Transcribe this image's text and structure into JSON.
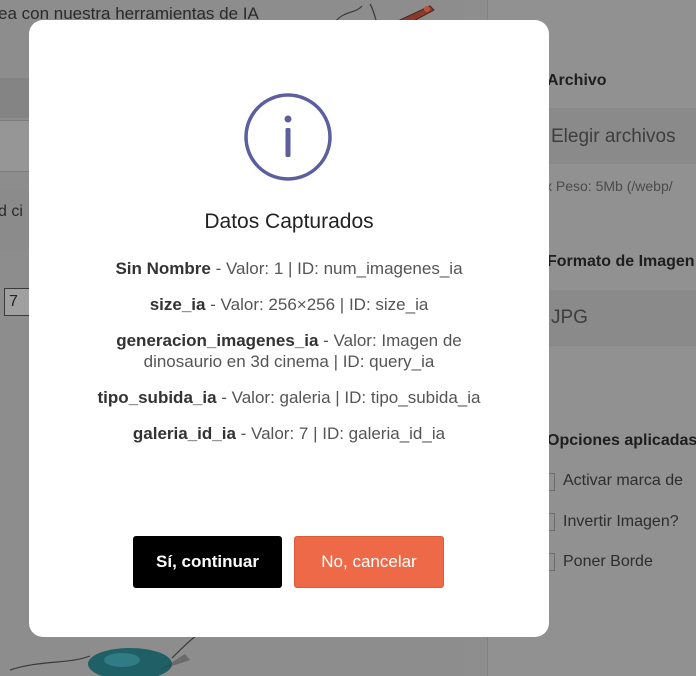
{
  "background": {
    "left_heading": "ea con nuestra herramientas de IA",
    "left_partial_text": "d ci",
    "left_input_value": "7",
    "right_panel": {
      "file_label": "Archivo",
      "choose_files": "Elegir archivos",
      "size_note": "x Peso: 5Mb (/webp/",
      "format_label": "Formato de Imagen",
      "format_value": "JPG",
      "options_label": "Opciones aplicadas",
      "options": [
        "Activar marca de",
        "Invertir Imagen?",
        "Poner Borde"
      ]
    }
  },
  "modal": {
    "icon": "info-icon",
    "title": "Datos Capturados",
    "fields": [
      {
        "name": "Sin Nombre",
        "detail": " - Valor: 1 | ID: num_imagenes_ia"
      },
      {
        "name": "size_ia",
        "detail": " - Valor: 256×256 | ID: size_ia"
      },
      {
        "name": "generacion_imagenes_ia",
        "detail": " - Valor: Imagen de dinosaurio en 3d cinema | ID: query_ia"
      },
      {
        "name": "tipo_subida_ia",
        "detail": " - Valor: galeria | ID: tipo_subida_ia"
      },
      {
        "name": "galeria_id_ia",
        "detail": " - Valor: 7 | ID: galeria_id_ia"
      }
    ],
    "confirm_label": "Sí, continuar",
    "cancel_label": "No, cancelar",
    "colors": {
      "icon": "#5b5f9e",
      "confirm_bg": "#000000",
      "cancel_bg": "#ee6947"
    }
  }
}
